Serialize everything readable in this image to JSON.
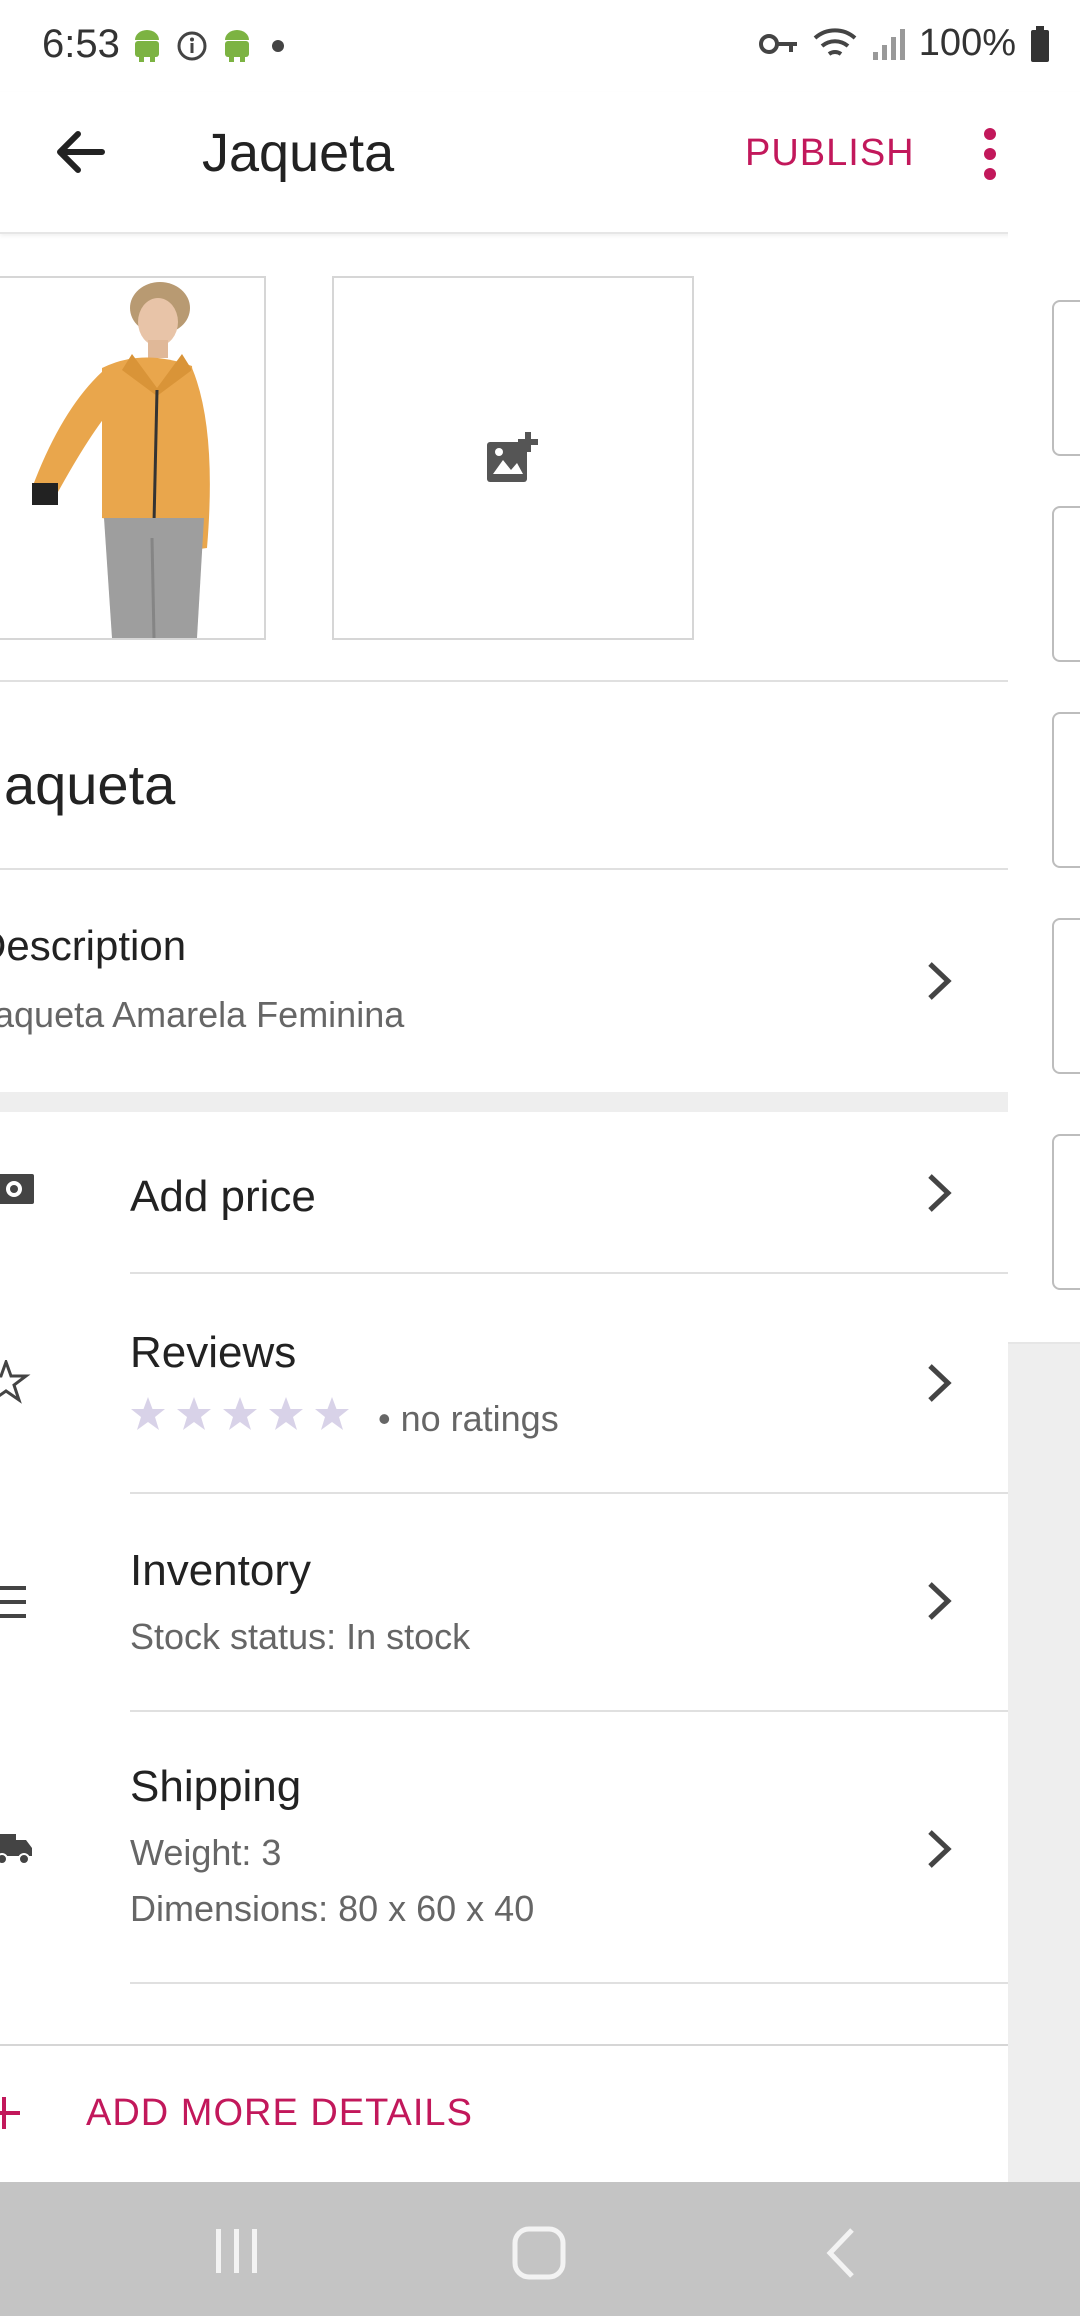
{
  "status_bar": {
    "time": "6:53",
    "battery": "100%",
    "icons": [
      "android-icon",
      "info-icon",
      "android-icon",
      "dot-icon",
      "vpn-key-icon",
      "wifi-icon",
      "signal-icon",
      "battery-icon"
    ]
  },
  "app_bar": {
    "title": "Jaqueta",
    "publish_label": "PUBLISH",
    "accent_color": "#c2185b"
  },
  "product": {
    "name": "Jaqueta",
    "description_label": "Description",
    "description_value": "Jaqueta Amarela Feminina"
  },
  "details": {
    "price": {
      "title": "Add price",
      "icon": "money-icon"
    },
    "reviews": {
      "title": "Reviews",
      "rating_text": "• no ratings",
      "stars_filled": 0,
      "stars_total": 5,
      "icon": "star-icon"
    },
    "inventory": {
      "title": "Inventory",
      "subtitle": "Stock status: In stock",
      "icon": "list-icon"
    },
    "shipping": {
      "title": "Shipping",
      "weight": "Weight: 3",
      "dimensions": "Dimensions: 80 x 60 x 40",
      "icon": "truck-icon"
    }
  },
  "add_more_label": "ADD MORE DETAILS"
}
